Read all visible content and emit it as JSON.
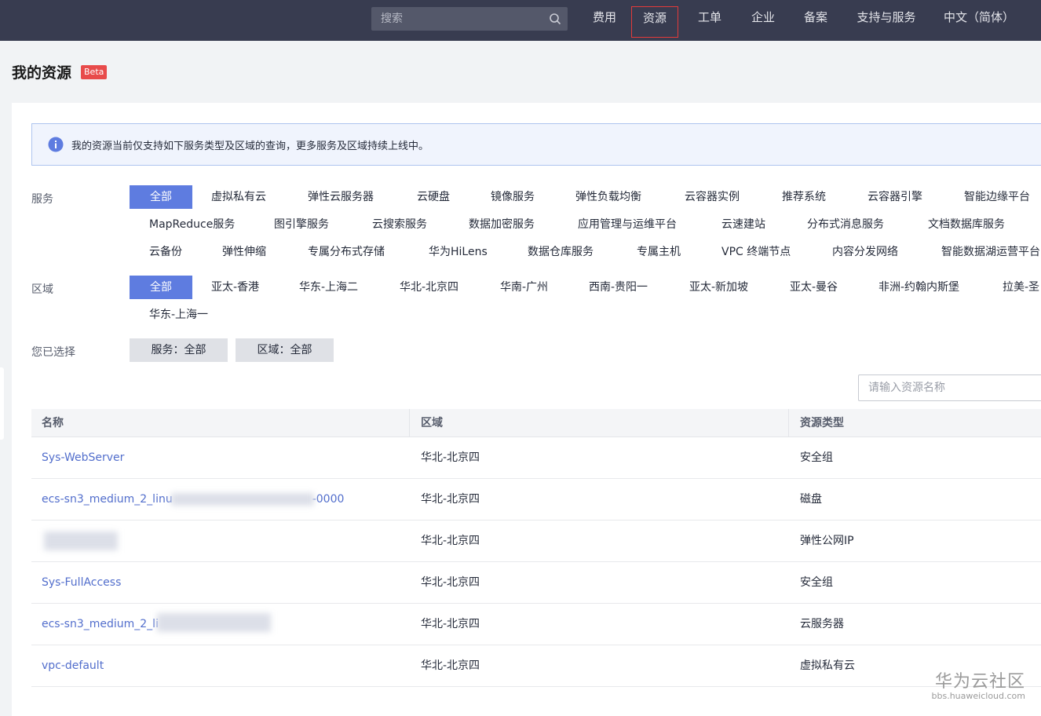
{
  "topnav": {
    "search_placeholder": "搜索",
    "items": [
      "费用",
      "资源",
      "工单",
      "企业",
      "备案",
      "支持与服务",
      "中文（简体）"
    ],
    "active": "资源"
  },
  "page": {
    "title": "我的资源",
    "badge": "Beta"
  },
  "notice": "我的资源当前仅支持如下服务类型及区域的查询，更多服务及区域持续上线中。",
  "filters": {
    "service_label": "服务",
    "services": [
      "全部",
      "虚拟私有云",
      "弹性云服务器",
      "云硬盘",
      "镜像服务",
      "弹性负载均衡",
      "云容器实例",
      "推荐系统",
      "云容器引擎",
      "智能边缘平台",
      "MapReduce服务",
      "图引擎服务",
      "云搜索服务",
      "数据加密服务",
      "应用管理与运维平台",
      "云速建站",
      "分布式消息服务",
      "文档数据库服务",
      "云备份",
      "弹性伸缩",
      "专属分布式存储",
      "华为HiLens",
      "数据仓库服务",
      "专属主机",
      "VPC 终端节点",
      "内容分发网络",
      "智能数据湖运营平台"
    ],
    "region_label": "区域",
    "regions": [
      "全部",
      "亚太-香港",
      "华东-上海二",
      "华北-北京四",
      "华南-广州",
      "西南-贵阳一",
      "亚太-新加坡",
      "亚太-曼谷",
      "非洲-约翰内斯堡",
      "拉美-圣",
      "华东-上海一"
    ],
    "selected_label": "您已选择",
    "selected_tags": [
      "服务：全部",
      "区域：全部"
    ]
  },
  "resource_search_placeholder": "请输入资源名称",
  "table": {
    "columns": [
      "名称",
      "区域",
      "资源类型"
    ],
    "rows": [
      {
        "name": "Sys-WebServer",
        "region": "华北-北京四",
        "type": "安全组"
      },
      {
        "name": "ecs-sn3_medium_2_linu",
        "name_suffix": "-0000",
        "region": "华北-北京四",
        "type": "磁盘"
      },
      {
        "name": "",
        "region": "华北-北京四",
        "type": "弹性公网IP"
      },
      {
        "name": "Sys-FullAccess",
        "region": "华北-北京四",
        "type": "安全组"
      },
      {
        "name": "ecs-sn3_medium_2_li",
        "region": "华北-北京四",
        "type": "云服务器"
      },
      {
        "name": "vpc-default",
        "region": "华北-北京四",
        "type": "虚拟私有云"
      }
    ]
  },
  "watermark": {
    "main": "华为云社区",
    "sub": "bbs.huaweicloud.com"
  }
}
